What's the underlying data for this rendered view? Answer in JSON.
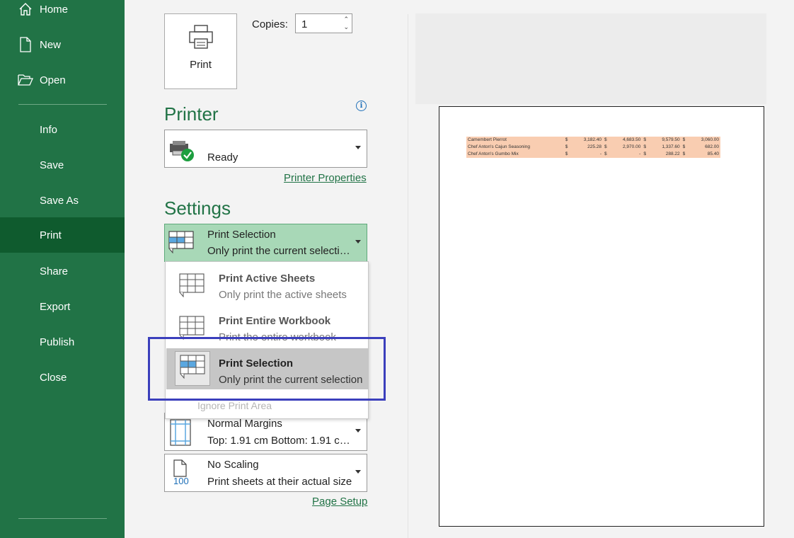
{
  "sidebar": {
    "items": [
      {
        "label": "Home",
        "icon": "home-icon"
      },
      {
        "label": "New",
        "icon": "new-document-icon"
      },
      {
        "label": "Open",
        "icon": "open-folder-icon"
      },
      {
        "label": "Info"
      },
      {
        "label": "Save"
      },
      {
        "label": "Save As"
      },
      {
        "label": "Print",
        "active": true
      },
      {
        "label": "Share"
      },
      {
        "label": "Export"
      },
      {
        "label": "Publish"
      },
      {
        "label": "Close"
      }
    ]
  },
  "print_button": {
    "label": "Print"
  },
  "copies": {
    "label": "Copies:",
    "value": "1"
  },
  "printer": {
    "heading": "Printer",
    "status": "Ready",
    "properties_link": "Printer Properties"
  },
  "settings": {
    "heading": "Settings",
    "selected": {
      "title": "Print Selection",
      "subtitle": "Only print the current selecti…"
    },
    "options": [
      {
        "title": "Print Active Sheets",
        "subtitle": "Only print the active sheets"
      },
      {
        "title": "Print Entire Workbook",
        "subtitle": "Print the entire workbook"
      },
      {
        "title": "Print Selection",
        "subtitle": "Only print the current selection"
      }
    ],
    "ignore_print_area": "Ignore Print Area",
    "margins": {
      "title": "Normal Margins",
      "subtitle": "Top: 1.91 cm Bottom: 1.91 c…"
    },
    "scaling": {
      "title": "No Scaling",
      "subtitle": "Print sheets at their actual size",
      "icon_text": "100"
    },
    "page_setup_link": "Page Setup"
  },
  "preview": {
    "rows": [
      {
        "name": "Camembert Pierrot",
        "c1": "$",
        "v1": "3,182.40",
        "c2": "$",
        "v2": "4,683.50",
        "c3": "$",
        "v3": "9,579.50",
        "c4": "$",
        "v4": "3,060.00"
      },
      {
        "name": "Chef Anton's Cajun Seasoning",
        "c1": "$",
        "v1": "225.28",
        "c2": "$",
        "v2": "2,970.00",
        "c3": "$",
        "v3": "1,337.60",
        "c4": "$",
        "v4": "682.00"
      },
      {
        "name": "Chef Anton's Gumbo Mix",
        "c1": "$",
        "v1": "-",
        "c2": "$",
        "v2": "-",
        "c3": "$",
        "v3": "288.22",
        "c4": "$",
        "v4": "85.40"
      }
    ]
  },
  "colors": {
    "brand": "#217346",
    "active_nav": "#0f5b2e",
    "selected_dropdown": "#a8d8b7",
    "highlight_border": "#3b3fbc",
    "cell_fill": "#f9cdb1"
  }
}
